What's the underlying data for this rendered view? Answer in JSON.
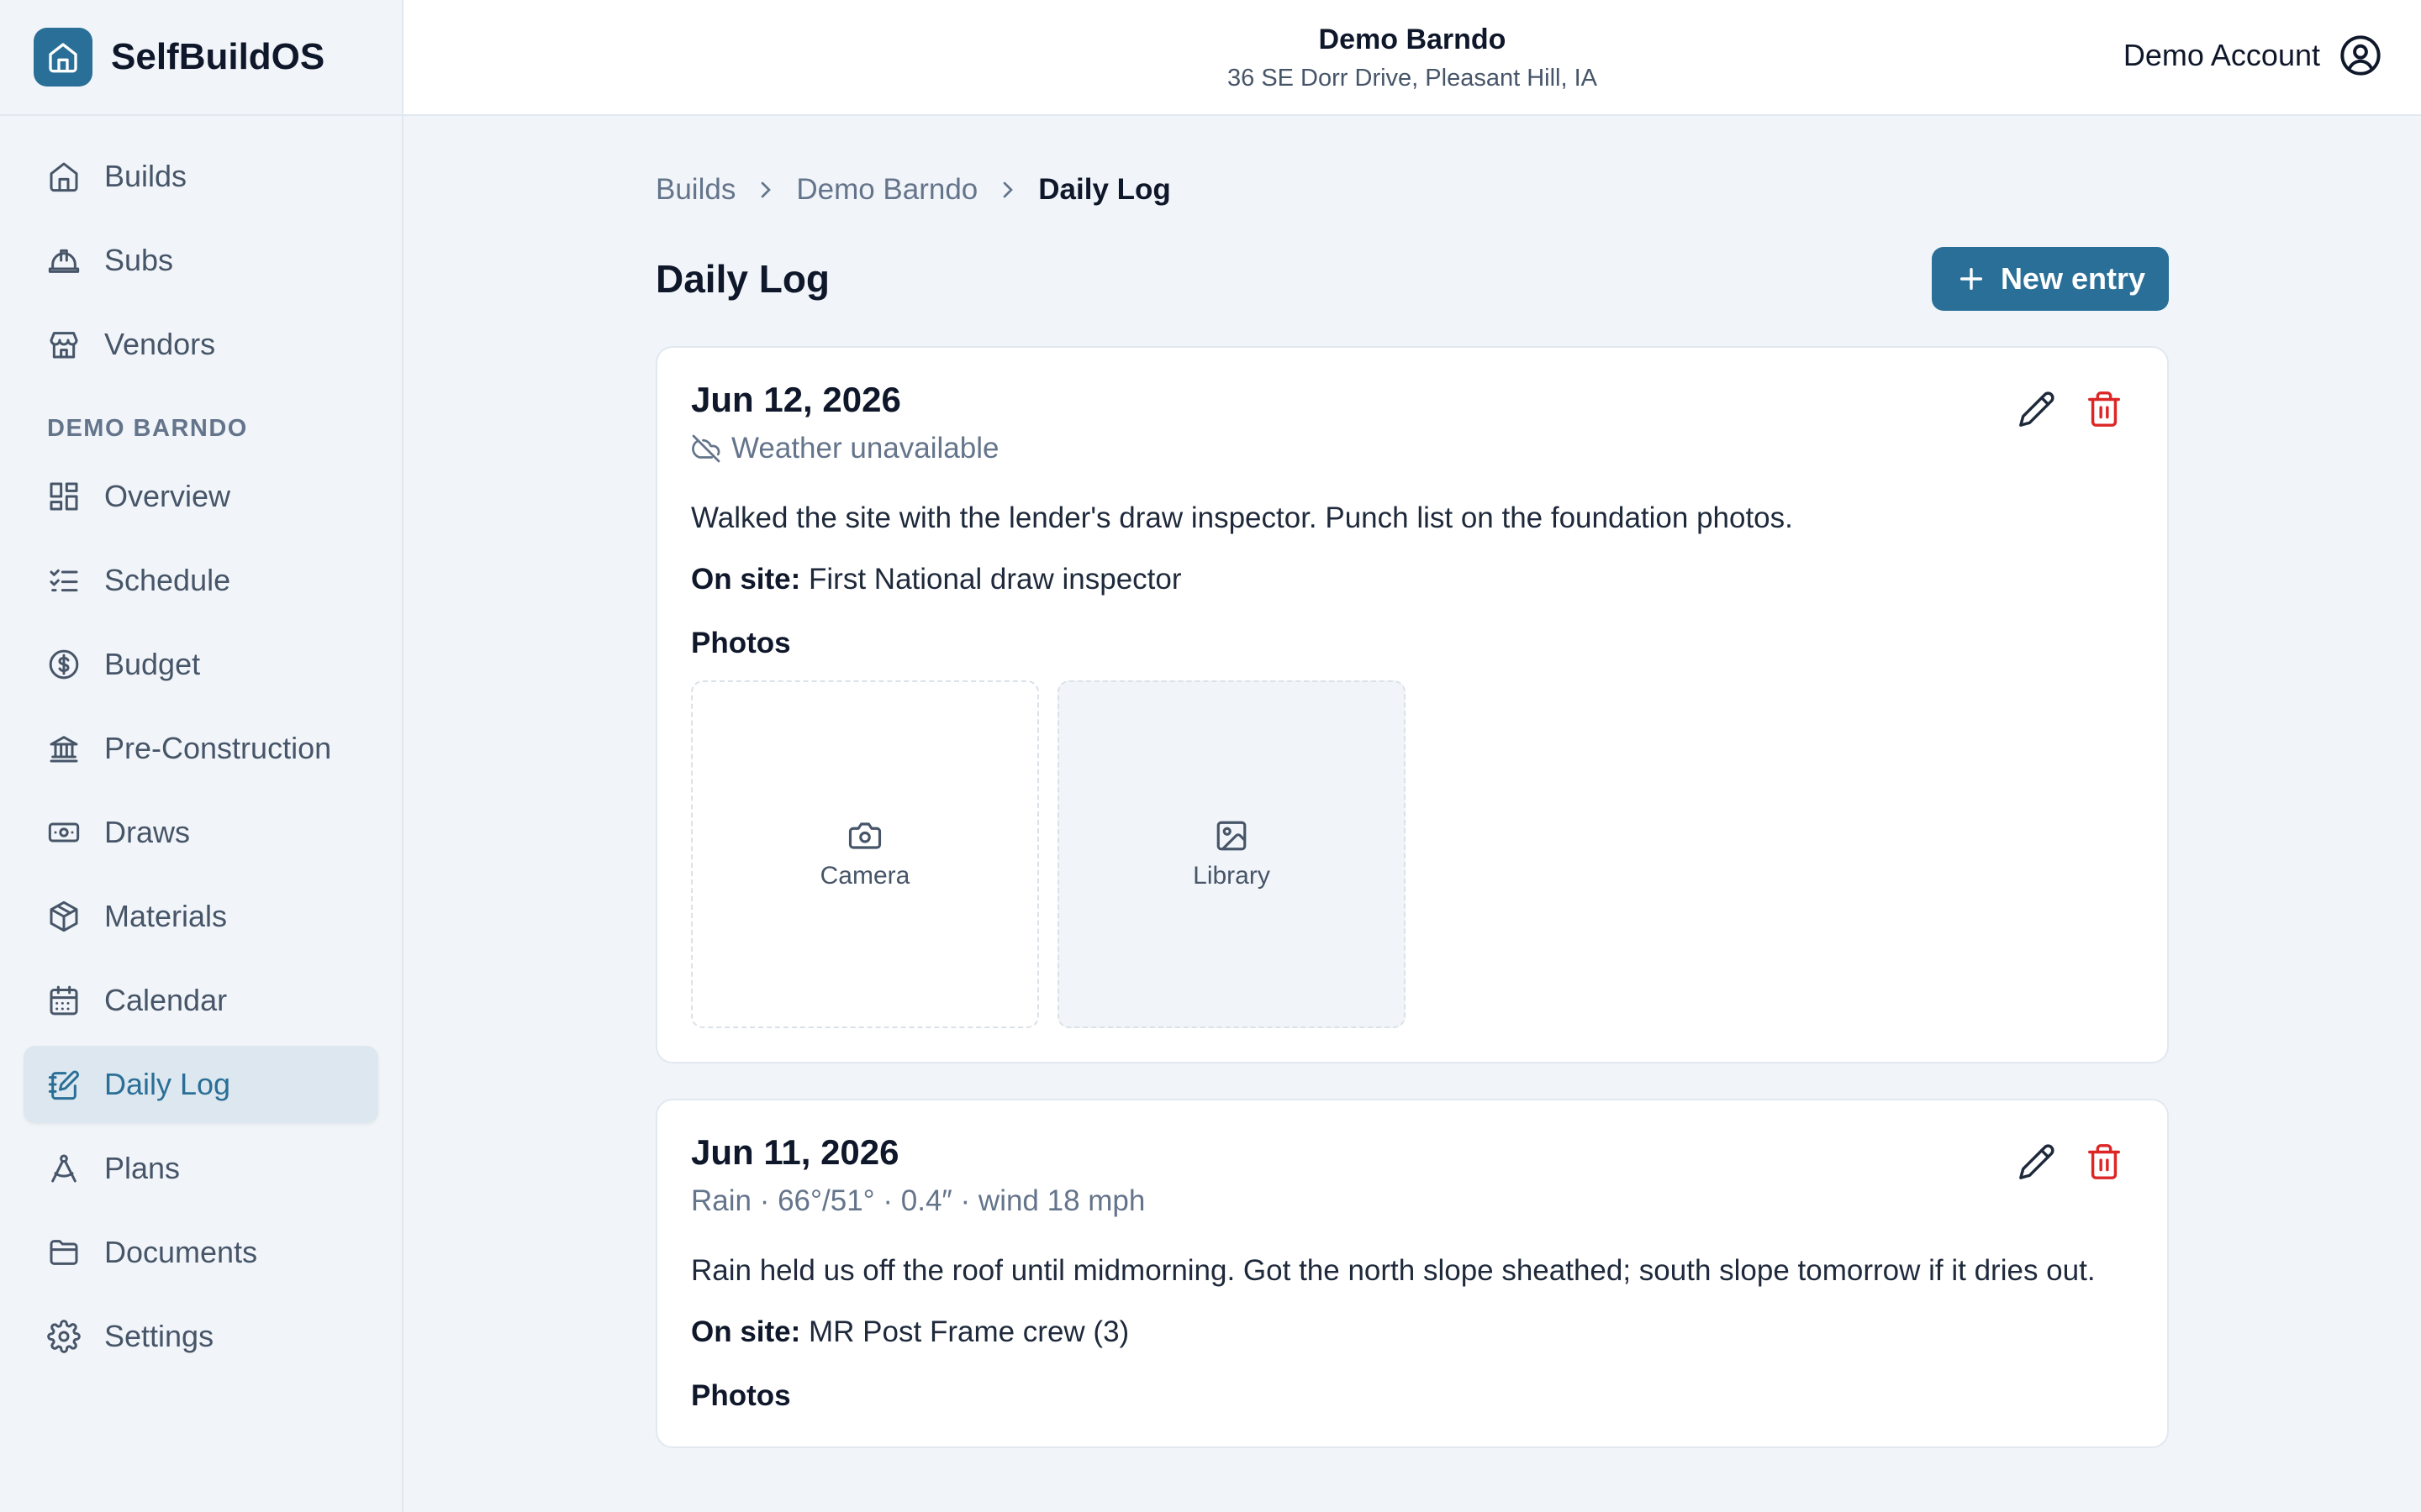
{
  "brand": {
    "name": "SelfBuildOS"
  },
  "project": {
    "name": "Demo Barndo",
    "address": "36 SE Dorr Drive, Pleasant Hill, IA"
  },
  "account": {
    "label": "Demo Account"
  },
  "sidebar": {
    "top_items": [
      {
        "label": "Builds",
        "icon": "home-icon"
      },
      {
        "label": "Subs",
        "icon": "hard-hat-icon"
      },
      {
        "label": "Vendors",
        "icon": "store-icon"
      }
    ],
    "section_label": "DEMO BARNDO",
    "project_items": [
      {
        "label": "Overview",
        "icon": "grid-icon"
      },
      {
        "label": "Schedule",
        "icon": "checklist-icon"
      },
      {
        "label": "Budget",
        "icon": "dollar-circle-icon"
      },
      {
        "label": "Pre-Construction",
        "icon": "bank-icon"
      },
      {
        "label": "Draws",
        "icon": "banknote-icon"
      },
      {
        "label": "Materials",
        "icon": "package-icon"
      },
      {
        "label": "Calendar",
        "icon": "calendar-icon"
      },
      {
        "label": "Daily Log",
        "icon": "notebook-pen-icon",
        "active": true
      },
      {
        "label": "Plans",
        "icon": "compass-icon"
      },
      {
        "label": "Documents",
        "icon": "folder-icon"
      },
      {
        "label": "Settings",
        "icon": "gear-icon"
      }
    ]
  },
  "breadcrumb": [
    "Builds",
    "Demo Barndo",
    "Daily Log"
  ],
  "page": {
    "title": "Daily Log",
    "new_button": "New entry"
  },
  "entries": [
    {
      "date": "Jun 12, 2026",
      "weather": "Weather unavailable",
      "text": "Walked the site with the lender's draw inspector. Punch list on the foundation photos.",
      "onsite_label": "On site:",
      "onsite": "First National draw inspector",
      "photos_label": "Photos",
      "camera_label": "Camera",
      "library_label": "Library"
    },
    {
      "date": "Jun 11, 2026",
      "weather": "Rain · 66°/51° · 0.4″ · wind 18 mph",
      "text": "Rain held us off the roof until midmorning. Got the north slope sheathed; south slope tomorrow if it dries out.",
      "onsite_label": "On site:",
      "onsite": "MR Post Frame crew (3)",
      "photos_label": "Photos"
    }
  ],
  "colors": {
    "accent": "#2a6f97",
    "danger": "#dc2626",
    "background": "#f1f5f9"
  }
}
